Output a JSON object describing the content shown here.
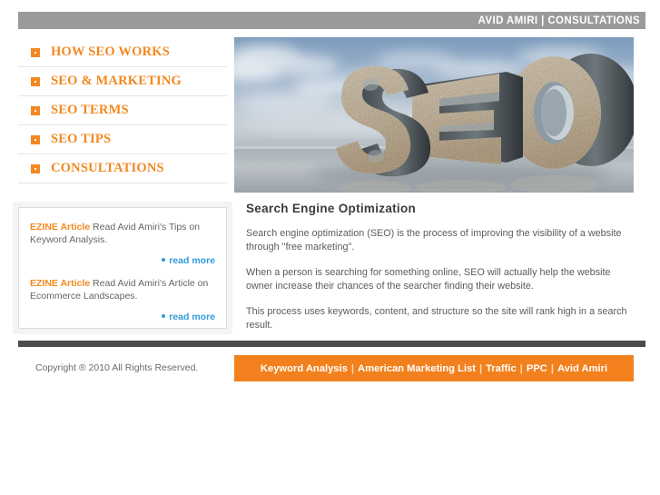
{
  "topbar": {
    "title": "AVID AMIRI | CONSULTATIONS"
  },
  "sidebar": {
    "icon": "grid-squares-icon",
    "items": [
      {
        "label": "HOW SEO WORKS"
      },
      {
        "label": "SEO & MARKETING"
      },
      {
        "label": "SEO TERMS"
      },
      {
        "label": "SEO TIPS"
      },
      {
        "label": "CONSULTATIONS"
      }
    ]
  },
  "ezine": {
    "entries": [
      {
        "tag": "EZINE Article",
        "text": " Read Avid Amiri's Tips on Keyword Analysis.",
        "read_more": "read more"
      },
      {
        "tag": "EZINE Article",
        "text": " Read Avid Amiri's Article on Ecommerce Landscapes.",
        "read_more": "read more"
      }
    ]
  },
  "hero": {
    "alt": "seo-3d-letters-image",
    "word": "SEO"
  },
  "main": {
    "title": "Search Engine Optimization",
    "paragraphs": [
      "Search engine optimization (SEO) is the process of improving the visibility of a website through \"free marketing\".",
      "When a person is searching for something online, SEO will actually help the website owner increase their chances of the searcher finding their website.",
      "This process uses keywords, content, and structure so the site will rank high in a search result."
    ]
  },
  "footer": {
    "copyright": "Copyright ® 2010 All Rights Reserved.",
    "separator": "|",
    "links": [
      {
        "label": "Keyword Analysis"
      },
      {
        "label": "American Marketing List"
      },
      {
        "label": "Traffic"
      },
      {
        "label": "PPC"
      },
      {
        "label": "Avid Amiri"
      }
    ]
  },
  "colors": {
    "accent_orange": "#f2881f",
    "topbar_gray": "#9a9a9a",
    "divider_dark": "#4b4b4b",
    "link_blue": "#2f9bdc",
    "body_text": "#5c5c5c"
  }
}
